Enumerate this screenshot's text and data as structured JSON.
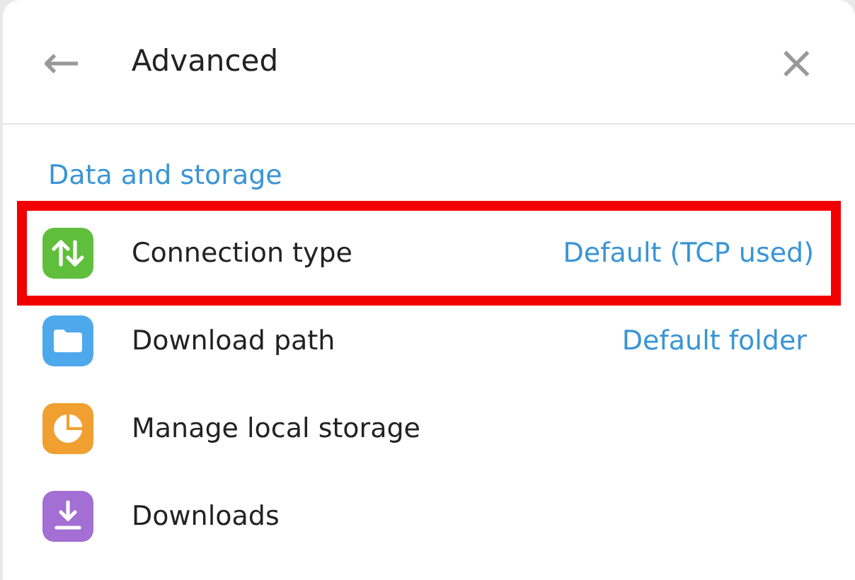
{
  "header": {
    "back": "←",
    "title": "Advanced",
    "close": "×"
  },
  "section": {
    "title": "Data and storage"
  },
  "rows": [
    {
      "color": "#5fbf3c",
      "label": "Connection type",
      "value": "Default (TCP used)",
      "highlighted": true
    },
    {
      "color": "#4ea8ec",
      "label": "Download path",
      "value": "Default folder",
      "highlighted": false
    },
    {
      "color": "#f0a030",
      "label": "Manage local storage",
      "highlighted": false
    },
    {
      "color": "#a36fd4",
      "label": "Downloads",
      "highlighted": false
    }
  ]
}
